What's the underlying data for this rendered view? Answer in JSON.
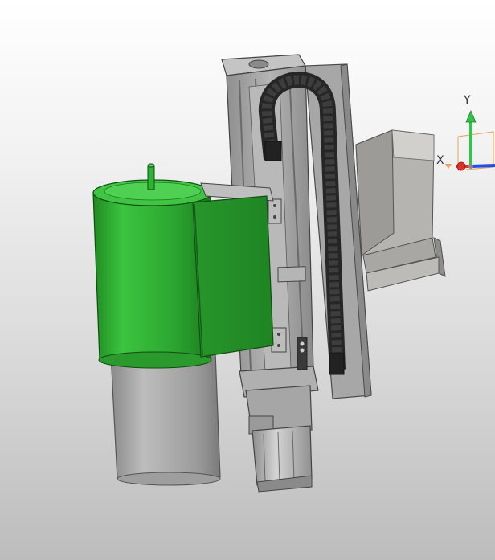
{
  "viewport": {
    "background_top": "#ffffff",
    "background_bottom": "#bcbcbc"
  },
  "triad": {
    "x_label": "X",
    "y_label": "Y",
    "x_color": "#e0302a",
    "y_color": "#35c24a",
    "z_color": "#2250e0",
    "plane_color": "#e8a55a"
  },
  "model": {
    "tank_color": "#2ba52f",
    "gearbox_color": "#a8a8a8",
    "frame_color": "#a4a4a4",
    "cable_chain_color": "#2b2b2b",
    "hopper_color": "#b0aeaa"
  }
}
